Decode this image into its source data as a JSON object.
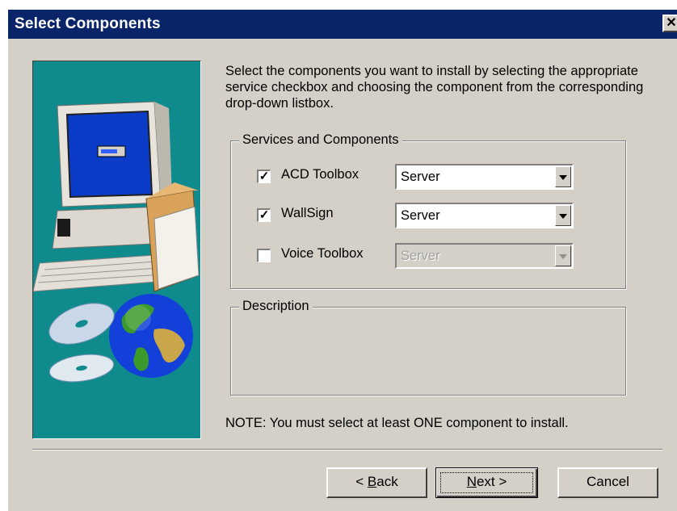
{
  "window": {
    "title": "Select Components",
    "close_glyph": "✕"
  },
  "instructions": "Select the components you want to install by selecting the appropriate service checkbox and choosing the component from the corresponding drop-down listbox.",
  "services_group": {
    "label": "Services and Components",
    "items": [
      {
        "label": "ACD Toolbox",
        "checked": true,
        "check_glyph": "✓",
        "component": "Server",
        "enabled": true
      },
      {
        "label": "WallSign",
        "checked": true,
        "check_glyph": "✓",
        "component": "Server",
        "enabled": true
      },
      {
        "label": "Voice Toolbox",
        "checked": false,
        "check_glyph": "",
        "component": "Server",
        "enabled": false
      }
    ]
  },
  "description_group": {
    "label": "Description",
    "text": ""
  },
  "note": "NOTE: You must select at least ONE component to install.",
  "buttons": {
    "back_accel": "B",
    "back_rest": "ack",
    "back_prefix": "< ",
    "next_accel": "N",
    "next_rest": "ext >",
    "cancel": "Cancel"
  },
  "colors": {
    "titlebar": "#0a246a",
    "dialog_face": "#d4d0c8",
    "art_background": "#0f8b8d"
  },
  "icons": [
    "computer-illustration",
    "cd-discs-illustration",
    "globe-illustration"
  ]
}
